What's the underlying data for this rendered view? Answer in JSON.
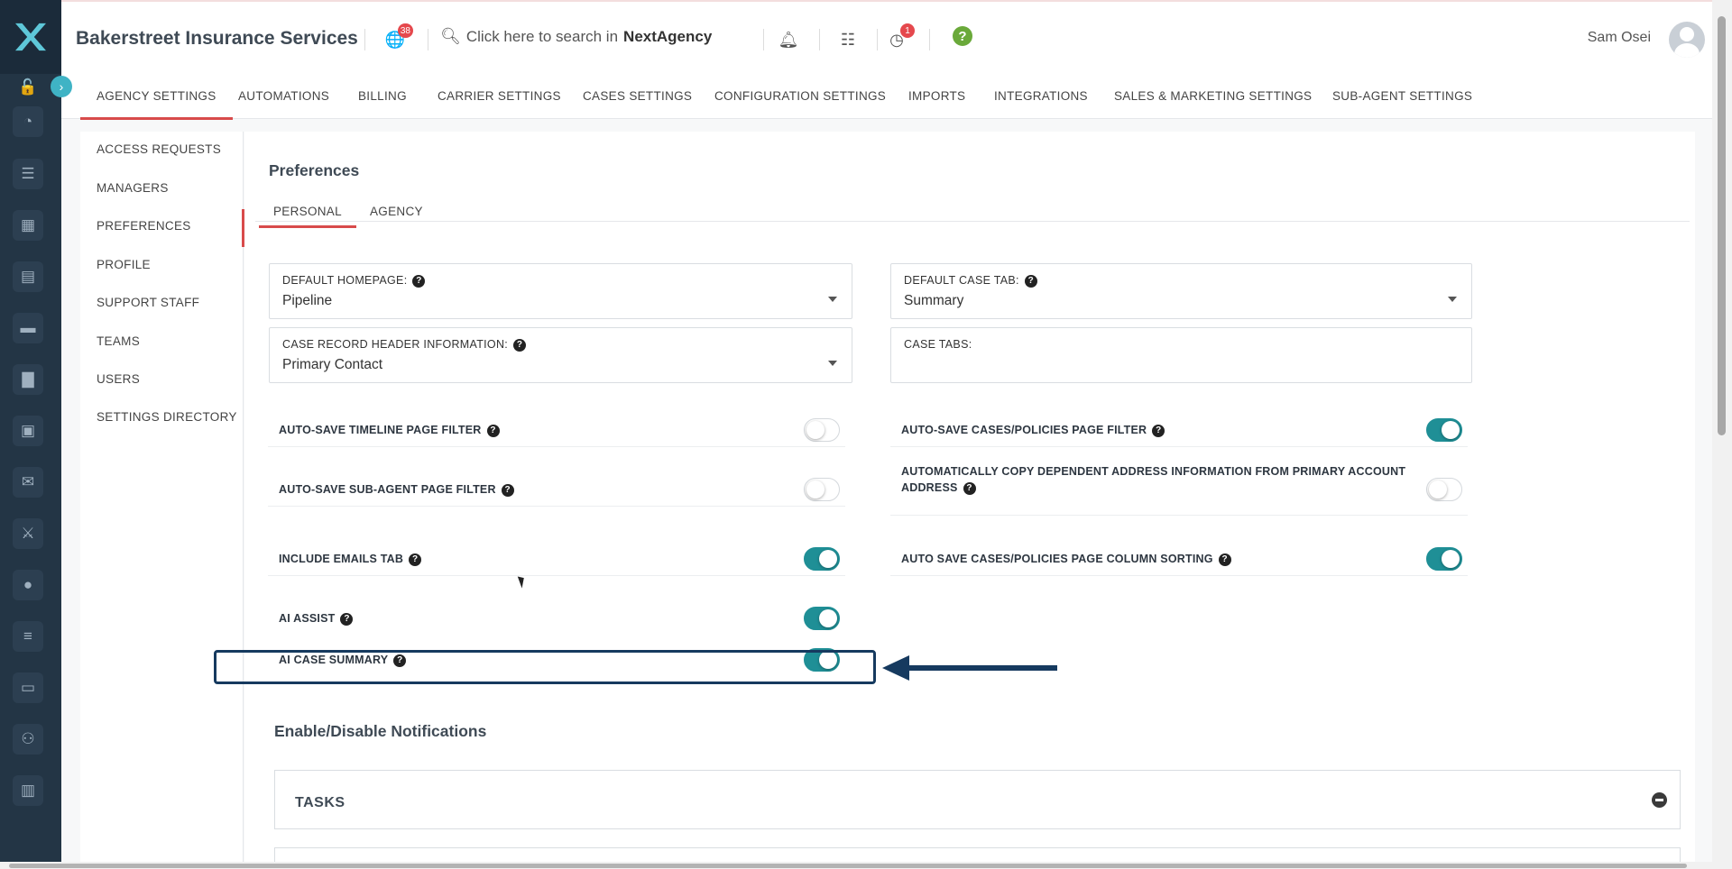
{
  "app": {
    "brand": "Bakerstreet Insurance Services",
    "notifications_badge": "38",
    "alerts_badge": "1",
    "search_prefix": "Click here to search in",
    "search_product": "NextAgency",
    "user_name": "Sam Osei"
  },
  "rail": {
    "icons": [
      "unlock-icon",
      "pie-chart-icon",
      "list-icon",
      "grid-icon",
      "book-icon",
      "briefcase-icon",
      "bar-chart-icon",
      "calendar-icon",
      "mail-icon",
      "handshake-icon",
      "user-icon",
      "list-detail-icon",
      "monitor-icon",
      "users-icon",
      "clipboard-icon"
    ]
  },
  "main_tabs": [
    {
      "label": "AGENCY SETTINGS",
      "active": true
    },
    {
      "label": "AUTOMATIONS"
    },
    {
      "label": "BILLING"
    },
    {
      "label": "CARRIER SETTINGS"
    },
    {
      "label": "CASES SETTINGS"
    },
    {
      "label": "CONFIGURATION SETTINGS"
    },
    {
      "label": "IMPORTS"
    },
    {
      "label": "INTEGRATIONS"
    },
    {
      "label": "SALES & MARKETING SETTINGS"
    },
    {
      "label": "SUB-AGENT SETTINGS"
    }
  ],
  "side_menu": [
    {
      "label": "ACCESS REQUESTS"
    },
    {
      "label": "MANAGERS"
    },
    {
      "label": "PREFERENCES",
      "active": true
    },
    {
      "label": "PROFILE"
    },
    {
      "label": "SUPPORT STAFF"
    },
    {
      "label": "TEAMS"
    },
    {
      "label": "USERS"
    },
    {
      "label": "SETTINGS DIRECTORY"
    }
  ],
  "preferences": {
    "title": "Preferences",
    "tabs": [
      {
        "label": "PERSONAL",
        "active": true
      },
      {
        "label": "AGENCY"
      }
    ],
    "fields": {
      "default_homepage": {
        "label": "DEFAULT HOMEPAGE:",
        "value": "Pipeline"
      },
      "default_case_tab": {
        "label": "DEFAULT CASE TAB:",
        "value": "Summary"
      },
      "case_record_header": {
        "label": "CASE RECORD HEADER INFORMATION:",
        "value": "Primary Contact"
      },
      "case_tabs": {
        "label": "CASE TABS:",
        "value": ""
      }
    },
    "toggles_left": [
      {
        "label": "AUTO-SAVE TIMELINE PAGE FILTER",
        "on": false
      },
      {
        "label": "AUTO-SAVE SUB-AGENT PAGE FILTER",
        "on": false
      },
      {
        "label": "INCLUDE EMAILS TAB",
        "on": true
      },
      {
        "label": "AI ASSIST",
        "on": true
      },
      {
        "label": "AI CASE SUMMARY",
        "on": true
      }
    ],
    "toggles_right": [
      {
        "label": "AUTO-SAVE CASES/POLICIES PAGE FILTER",
        "on": true
      },
      {
        "label": "AUTOMATICALLY COPY DEPENDENT ADDRESS INFORMATION FROM PRIMARY ACCOUNT ADDRESS",
        "on": false
      },
      {
        "label": "AUTO SAVE CASES/POLICIES PAGE COLUMN SORTING",
        "on": true
      }
    ]
  },
  "notifications": {
    "title": "Enable/Disable Notifications",
    "sections": [
      {
        "label": "TASKS"
      }
    ]
  },
  "colors": {
    "accent_red": "#d84b4b",
    "toggle_on": "#1f8f96",
    "highlight": "#163a5f",
    "rail_bg": "#233545"
  }
}
